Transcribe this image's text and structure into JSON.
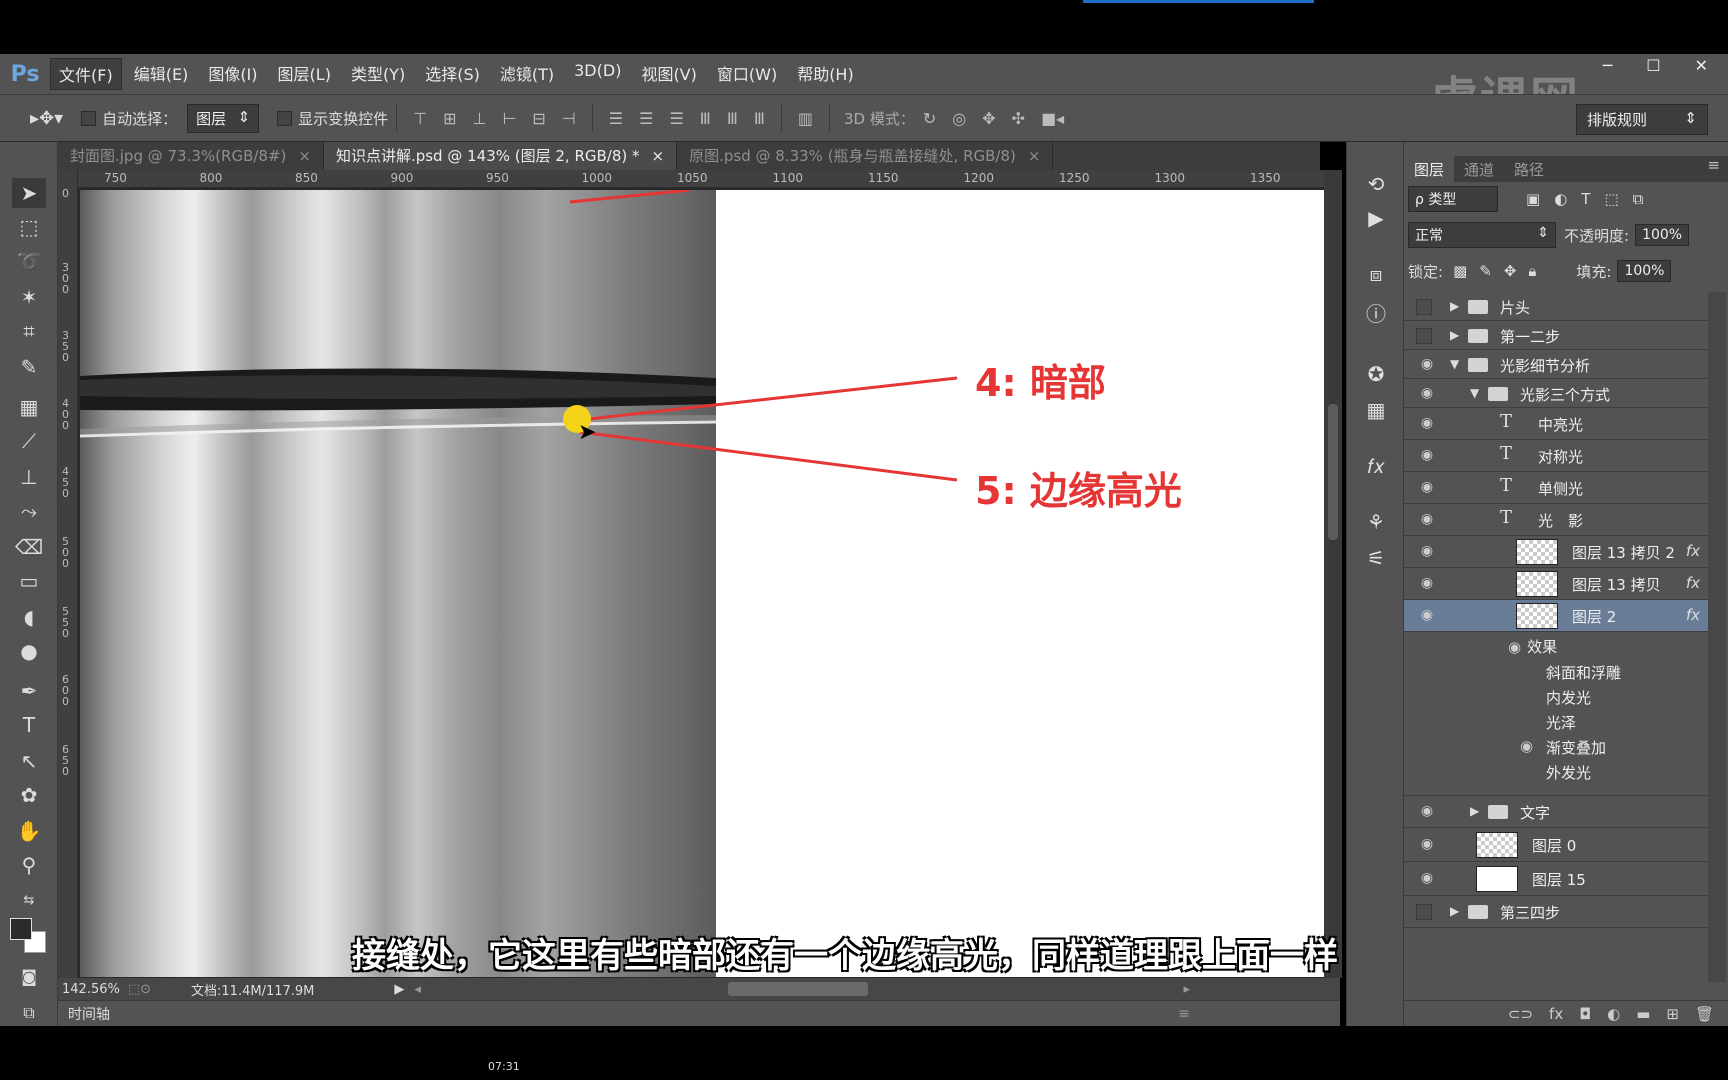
{
  "app": {
    "logo": "Ps"
  },
  "menu": [
    "文件(F)",
    "编辑(E)",
    "图像(I)",
    "图层(L)",
    "类型(Y)",
    "选择(S)",
    "滤镜(T)",
    "3D(D)",
    "视图(V)",
    "窗口(W)",
    "帮助(H)"
  ],
  "window_controls": [
    "─",
    "☐",
    "✕"
  ],
  "watermark": "虎课网",
  "options": {
    "auto_select_label": "自动选择：",
    "auto_select_value": "图层",
    "show_transform_label": "显示变换控件",
    "mode_3d_label": "3D 模式：",
    "workspace_label": "排版规则"
  },
  "doc_tabs": [
    {
      "label": "封面图.jpg @ 73.3%(RGB/8#)",
      "active": false
    },
    {
      "label": "知识点讲解.psd @ 143% (图层 2, RGB/8) *",
      "active": true
    },
    {
      "label": "原图.psd @ 8.33% (瓶身与瓶盖接缝处, RGB/8)",
      "active": false
    }
  ],
  "ruler_h": [
    "750",
    "800",
    "850",
    "900",
    "950",
    "1000",
    "1050",
    "1100",
    "1150",
    "1200",
    "1250",
    "1300",
    "1350"
  ],
  "ruler_v": [
    "0",
    "300",
    "350",
    "400",
    "450",
    "500",
    "550",
    "600",
    "650"
  ],
  "annotations": {
    "dark": "4: 暗部",
    "edge": "5: 边缘高光"
  },
  "subtitle": "接缝处，它这里有些暗部还有一个边缘高光，同样道理跟上面一样",
  "status": {
    "zoom": "142.56%",
    "doc": "文档:11.4M/117.9M"
  },
  "timeline_label": "时间轴",
  "clock": "07:31",
  "panel": {
    "tabs": [
      "图层",
      "通道",
      "路径"
    ],
    "filter_kind": "ρ 类型",
    "blend_mode": "正常",
    "opacity_label": "不透明度:",
    "opacity_value": "100%",
    "lock_label": "锁定:",
    "fill_label": "填充:",
    "fill_value": "100%",
    "layers": [
      {
        "name": "片头",
        "kind": "group",
        "visible": false,
        "indent": 0,
        "expanded": false
      },
      {
        "name": "第一二步",
        "kind": "group",
        "visible": false,
        "indent": 0,
        "expanded": false
      },
      {
        "name": "光影细节分析",
        "kind": "group",
        "visible": true,
        "indent": 0,
        "expanded": true
      },
      {
        "name": "光影三个方式",
        "kind": "group",
        "visible": true,
        "indent": 1,
        "expanded": true
      },
      {
        "name": "中亮光",
        "kind": "text",
        "visible": true,
        "indent": 2
      },
      {
        "name": "对称光",
        "kind": "text",
        "visible": true,
        "indent": 2
      },
      {
        "name": "单侧光",
        "kind": "text",
        "visible": true,
        "indent": 2
      },
      {
        "name": "光　影",
        "kind": "text",
        "visible": true,
        "indent": 2
      },
      {
        "name": "图层 13 拷贝 2",
        "kind": "pixel",
        "visible": true,
        "indent": 2,
        "fx": "fx"
      },
      {
        "name": "图层 13 拷贝",
        "kind": "pixel",
        "visible": true,
        "indent": 2,
        "fx": "fx"
      },
      {
        "name": "图层 2",
        "kind": "pixel",
        "visible": true,
        "indent": 2,
        "fx": "fx",
        "selected": true
      }
    ],
    "effects_label": "效果",
    "effects": [
      "斜面和浮雕",
      "内发光",
      "光泽",
      "渐变叠加",
      "外发光"
    ],
    "layers_after": [
      {
        "name": "文字",
        "kind": "group",
        "visible": true,
        "indent": 1,
        "expanded": false
      },
      {
        "name": "图层 0",
        "kind": "pixel",
        "visible": true,
        "indent": 1
      },
      {
        "name": "图层 15",
        "kind": "pixel-white",
        "visible": true,
        "indent": 1
      },
      {
        "name": "第三四步",
        "kind": "group",
        "visible": false,
        "indent": 0,
        "expanded": false
      }
    ]
  }
}
